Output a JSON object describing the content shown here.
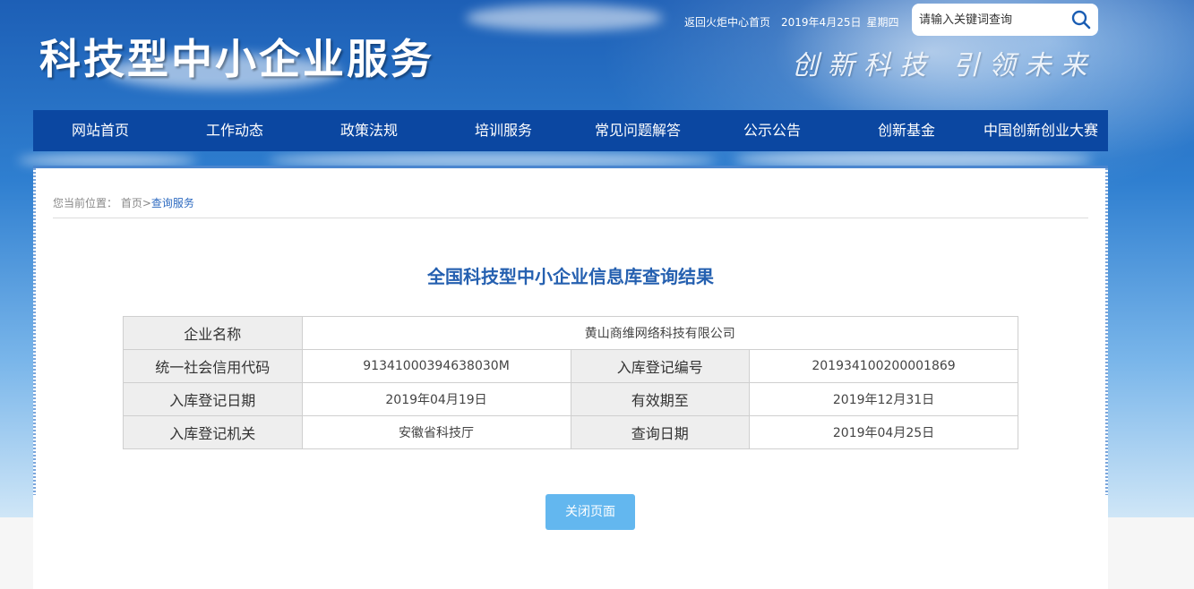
{
  "header": {
    "site_title": "科技型中小企业服务",
    "slogan": "创新科技 引领未来",
    "return_link": "返回火炬中心首页",
    "date": "2019年4月25日",
    "weekday": "星期四",
    "search_placeholder": "请输入关键词查询"
  },
  "nav": {
    "items": [
      "网站首页",
      "工作动态",
      "政策法规",
      "培训服务",
      "常见问题解答",
      "公示公告",
      "创新基金",
      "中国创新创业大赛"
    ]
  },
  "breadcrumb": {
    "prefix": "您当前位置：",
    "home": "首页",
    "separator": ">",
    "current": "查询服务"
  },
  "result": {
    "title": "全国科技型中小企业信息库查询结果",
    "company_label": "企业名称",
    "company_value": "黄山商维网络科技有限公司",
    "credit_code_label": "统一社会信用代码",
    "credit_code_value": "91341000394638030M",
    "reg_no_label": "入库登记编号",
    "reg_no_value": "201934100200001869",
    "reg_date_label": "入库登记日期",
    "reg_date_value": "2019年04月19日",
    "valid_until_label": "有效期至",
    "valid_until_value": "2019年12月31日",
    "authority_label": "入库登记机关",
    "authority_value": "安徽省科技厅",
    "query_date_label": "查询日期",
    "query_date_value": "2019年04月25日"
  },
  "close_button": "关闭页面",
  "colors": {
    "nav_bg": "#0b47a1",
    "title_blue": "#2560b0",
    "button_bg": "#63b7ef",
    "label_bg": "#eeeeee"
  }
}
